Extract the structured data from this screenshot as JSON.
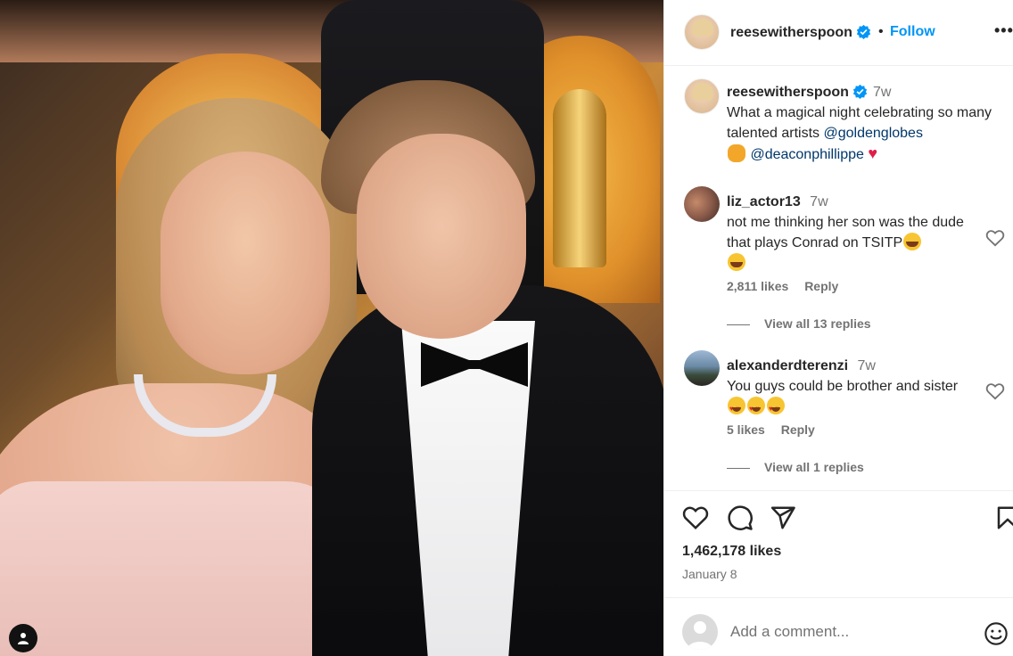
{
  "post": {
    "author": "reesewitherspoon",
    "follow_label": "Follow",
    "dot": "•",
    "more": "•••",
    "caption_time": "7w",
    "caption_line1": "What a magical night celebrating so many talented artists",
    "mention1": "@goldenglobes",
    "mention2": "@deaconphillippe",
    "likes": "1,462,178 likes",
    "date": "January 8"
  },
  "comments": [
    {
      "user": "liz_actor13",
      "time": "7w",
      "text": "not me thinking her son was the dude that plays Conrad on TSITP",
      "likes": "2,811 likes",
      "reply": "Reply",
      "view_replies": "View all 13 replies"
    },
    {
      "user": "alexanderdterenzi",
      "time": "7w",
      "text": "You guys could be brother and sister",
      "likes": "5 likes",
      "reply": "Reply",
      "view_replies": "View all 1 replies"
    }
  ],
  "comment_box": {
    "placeholder": "Add a comment..."
  },
  "colors": {
    "accent": "#0095f6",
    "mention": "#00376b",
    "muted": "#737373"
  }
}
